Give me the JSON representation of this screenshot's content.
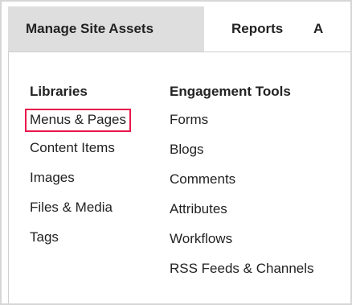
{
  "tabs": [
    {
      "label": "Manage Site Assets",
      "active": true
    },
    {
      "label": "Reports",
      "active": false
    },
    {
      "label": "A",
      "active": false
    }
  ],
  "libraries": {
    "heading": "Libraries",
    "items": [
      "Menus & Pages",
      "Content Items",
      "Images",
      "Files & Media",
      "Tags"
    ],
    "highlighted": "Menus & Pages",
    "highlight_color": "#e8184a"
  },
  "engagement": {
    "heading": "Engagement Tools",
    "items": [
      "Forms",
      "Blogs",
      "Comments",
      "Attributes",
      "Workflows",
      "RSS Feeds & Channels"
    ]
  },
  "colors": {
    "active_tab_bg": "#dedede",
    "text": "#222222",
    "border": "#d6d6d6"
  }
}
